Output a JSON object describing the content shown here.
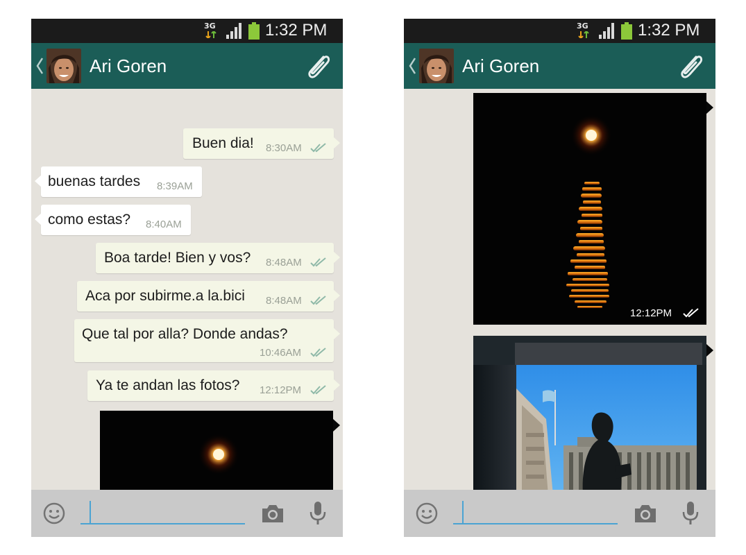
{
  "status_bar": {
    "network": "3G",
    "time": "1:32 PM"
  },
  "header": {
    "contact_name": "Ari Goren"
  },
  "left_screen": {
    "messages": [
      {
        "direction": "out",
        "text": "Buen dia!",
        "time": "8:30AM",
        "status": "read"
      },
      {
        "direction": "in",
        "text": "buenas tardes",
        "time": "8:39AM"
      },
      {
        "direction": "in",
        "text": "como estas?",
        "time": "8:40AM"
      },
      {
        "direction": "out",
        "text": "Boa tarde! Bien y vos?",
        "time": "8:48AM",
        "status": "read"
      },
      {
        "direction": "out",
        "text": "Aca por subirme.a la.bici",
        "time": "8:48AM",
        "status": "read"
      },
      {
        "direction": "out",
        "text": "Que tal por alla? Donde andas?",
        "time": "10:46AM",
        "status": "read"
      },
      {
        "direction": "out",
        "text": "Ya te andan las fotos?",
        "time": "12:12PM",
        "status": "read"
      }
    ]
  },
  "right_screen": {
    "photos": [
      {
        "subject": "moon-over-water",
        "time": "12:12PM",
        "status": "read"
      },
      {
        "subject": "silhouette-at-monument",
        "time": "",
        "status": "read"
      }
    ]
  },
  "input_bar": {
    "placeholder": "",
    "value": ""
  },
  "icons": {
    "back": "chevron-left-icon",
    "attach": "paperclip-icon",
    "emoji": "smiley-icon",
    "camera": "camera-icon",
    "mic": "microphone-icon",
    "read_receipt": "double-check-icon"
  },
  "colors": {
    "action_bar": "#1b5d57",
    "status_bar": "#1b1b1b",
    "chat_background": "#e5e2dc",
    "bubble_outgoing": "#f4f6e6",
    "bubble_incoming": "#ffffff",
    "input_underline": "#4aa3d3",
    "ticks": "#8fb9a8"
  }
}
